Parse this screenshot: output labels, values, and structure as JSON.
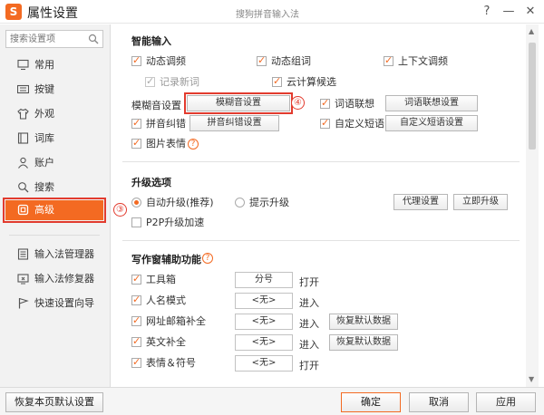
{
  "window": {
    "logo_char": "S",
    "title": "属性设置",
    "subtitle": "搜狗拼音输入法",
    "help": "?",
    "minimize": "—",
    "close": "✕"
  },
  "sidebar": {
    "search_placeholder": "搜索设置项",
    "items": [
      {
        "label": "常用",
        "icon": "display-icon"
      },
      {
        "label": "按键",
        "icon": "keyboard-icon"
      },
      {
        "label": "外观",
        "icon": "shirt-icon"
      },
      {
        "label": "词库",
        "icon": "book-icon"
      },
      {
        "label": "账户",
        "icon": "user-icon"
      },
      {
        "label": "搜索",
        "icon": "search-icon"
      },
      {
        "label": "高级",
        "icon": "advanced-icon"
      }
    ],
    "tools": [
      {
        "label": "输入法管理器",
        "icon": "manager-icon"
      },
      {
        "label": "输入法修复器",
        "icon": "repair-icon"
      },
      {
        "label": "快速设置向导",
        "icon": "flag-icon"
      }
    ],
    "marker": "③"
  },
  "smart_input": {
    "title": "智能输入",
    "dynamic_freq": "动态调频",
    "dynamic_words": "动态组词",
    "context_freq": "上下文调频",
    "record_new": "记录新词",
    "cloud_candidates": "云计算候选",
    "fuzzy_label": "模糊音设置",
    "fuzzy_button": "模糊音设置",
    "fuzzy_marker": "④",
    "word_assoc": "词语联想",
    "word_assoc_button": "词语联想设置",
    "pinyin_correct": "拼音纠错",
    "pinyin_correct_button": "拼音纠错设置",
    "custom_phrase": "自定义短语",
    "custom_phrase_button": "自定义短语设置",
    "emoji": "图片表情",
    "help": "?"
  },
  "upgrade": {
    "title": "升级选项",
    "auto": "自动升级(推荐)",
    "prompt": "提示升级",
    "proxy_button": "代理设置",
    "now_button": "立即升级",
    "p2p": "P2P升级加速"
  },
  "assist": {
    "title": "写作窗辅助功能",
    "help": "?",
    "rows": [
      {
        "label": "工具箱",
        "value": "分号",
        "action": "打开",
        "reset": ""
      },
      {
        "label": "人名模式",
        "value": "<无>",
        "action": "进入",
        "reset": ""
      },
      {
        "label": "网址邮箱补全",
        "value": "<无>",
        "action": "进入",
        "reset": "恢复默认数据"
      },
      {
        "label": "英文补全",
        "value": "<无>",
        "action": "进入",
        "reset": "恢复默认数据"
      },
      {
        "label": "表情＆符号",
        "value": "<无>",
        "action": "打开",
        "reset": ""
      }
    ]
  },
  "footer": {
    "restore": "恢复本页默认设置",
    "ok": "确定",
    "cancel": "取消",
    "apply": "应用"
  },
  "colors": {
    "accent": "#f36a22",
    "highlight_outline": "#e23b2e"
  }
}
